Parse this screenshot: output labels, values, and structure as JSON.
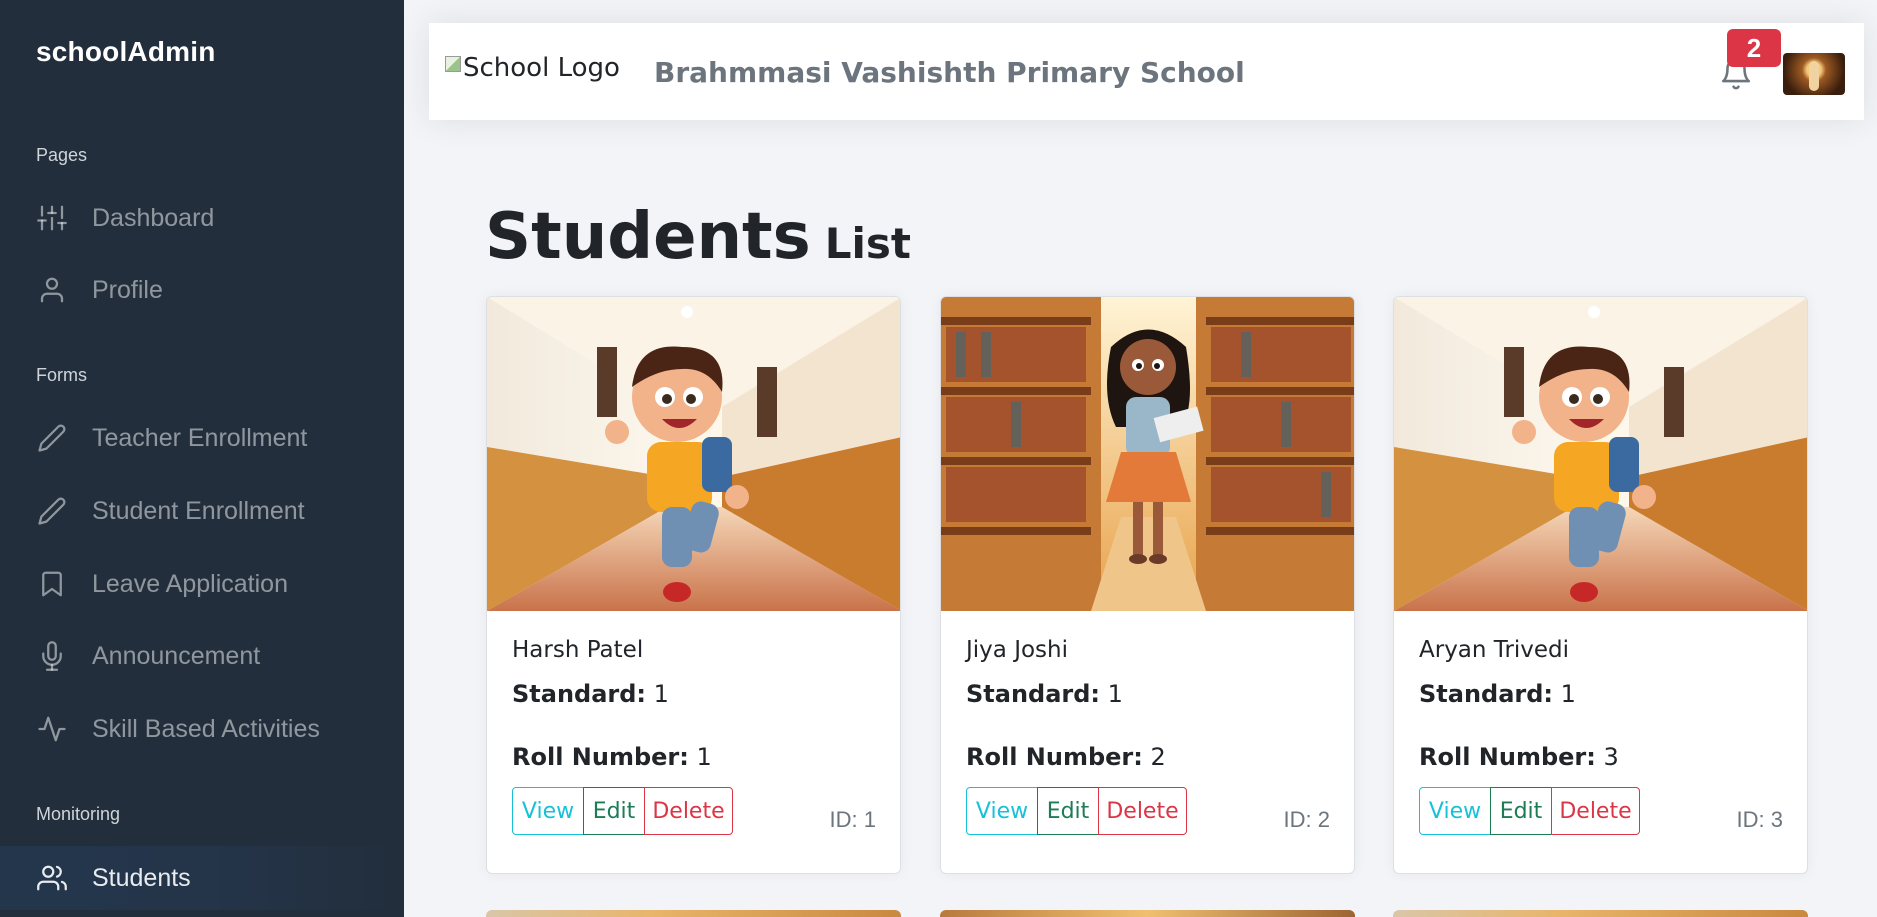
{
  "sidebar": {
    "brand": "schoolAdmin",
    "sections": [
      {
        "header": "Pages",
        "items": [
          {
            "label": "Dashboard",
            "icon": "sliders-icon"
          },
          {
            "label": "Profile",
            "icon": "user-icon"
          }
        ]
      },
      {
        "header": "Forms",
        "items": [
          {
            "label": "Teacher Enrollment",
            "icon": "pencil-icon"
          },
          {
            "label": "Student Enrollment",
            "icon": "pencil-icon"
          },
          {
            "label": "Leave Application",
            "icon": "bookmark-icon"
          },
          {
            "label": "Announcement",
            "icon": "mic-icon"
          },
          {
            "label": "Skill Based Activities",
            "icon": "activity-icon"
          }
        ]
      },
      {
        "header": "Monitoring",
        "items": [
          {
            "label": "Students",
            "icon": "users-icon",
            "active": true
          }
        ]
      }
    ]
  },
  "topbar": {
    "logo_alt": "School Logo",
    "school_name": "Brahmmasi Vashishth Primary School",
    "notification_count": "2"
  },
  "main": {
    "title_main": "Students",
    "title_sub": "List",
    "standard_label": "Standard:",
    "roll_label": "Roll Number:",
    "buttons": {
      "view": "View",
      "edit": "Edit",
      "delete": "Delete"
    },
    "students": [
      {
        "name": "Harsh Patel",
        "standard": "1",
        "roll": "1",
        "id": "ID: 1",
        "image": "boy-running-hallway"
      },
      {
        "name": "Jiya Joshi",
        "standard": "1",
        "roll": "2",
        "id": "ID: 2",
        "image": "girl-library"
      },
      {
        "name": "Aryan Trivedi",
        "standard": "1",
        "roll": "3",
        "id": "ID: 3",
        "image": "boy-running-hallway"
      }
    ]
  },
  "colors": {
    "sidebar_bg": "#222e3c",
    "badge": "#dc3545",
    "view": "#17c1d8",
    "edit": "#1c7c54",
    "delete": "#dc3545"
  }
}
